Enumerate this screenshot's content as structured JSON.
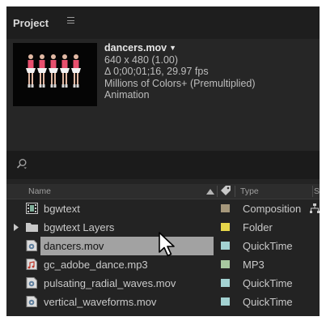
{
  "panel": {
    "title": "Project",
    "menu_icon": "hamburger-icon"
  },
  "preview": {
    "filename": "dancers.mov",
    "dropdown_caret": "▼",
    "resolution": "640 x 480 (1.00)",
    "duration_fps": "Δ 0;00;01;16, 29.97 fps",
    "color_depth": "Millions of Colors+ (Premultiplied)",
    "codec": "Animation"
  },
  "search": {
    "icon": "search-icon"
  },
  "columns": {
    "name": "Name",
    "type": "Type",
    "size": "Si"
  },
  "items": [
    {
      "name": "bgwtext",
      "type": "Composition",
      "icon": "composition-icon",
      "label_color": "#a5977b",
      "selected": false
    },
    {
      "name": "bgwtext Layers",
      "type": "Folder",
      "icon": "folder-icon",
      "label_color": "#e5d64a",
      "selected": false
    },
    {
      "name": "dancers.mov",
      "type": "QuickTime",
      "icon": "quicktime-file-icon",
      "label_color": "#a3d2d2",
      "selected": true
    },
    {
      "name": "gc_adobe_dance.mp3",
      "type": "MP3",
      "icon": "audio-file-icon",
      "label_color": "#a8c9a0",
      "selected": false
    },
    {
      "name": "pulsating_radial_waves.mov",
      "type": "QuickTime",
      "icon": "quicktime-file-icon",
      "label_color": "#a3d2d2",
      "selected": false
    },
    {
      "name": "vertical_waveforms.mov",
      "type": "QuickTime",
      "icon": "quicktime-file-icon",
      "label_color": "#a3d2d2",
      "selected": false
    }
  ],
  "colors": {
    "panel_bg": "#232323",
    "selection": "#a2a2a2",
    "text": "#c9c9c9"
  }
}
